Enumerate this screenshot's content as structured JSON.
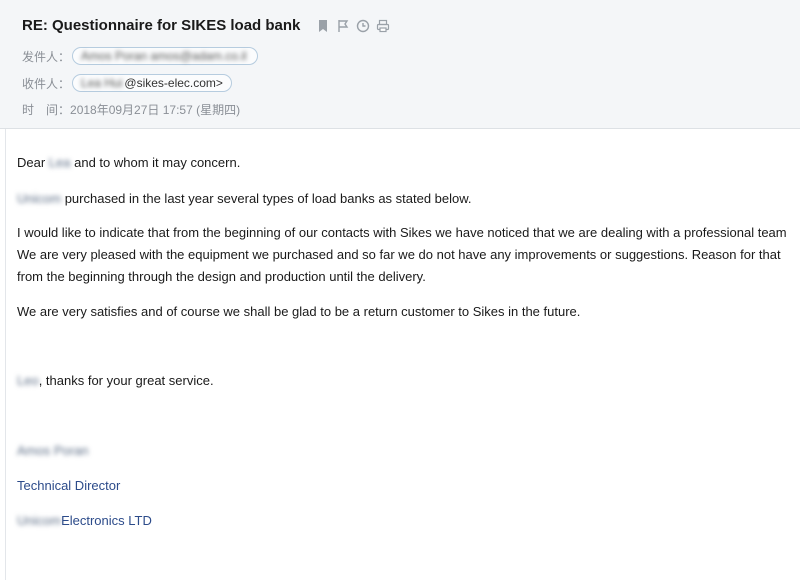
{
  "email": {
    "subject": "RE: Questionnaire for SIKES load bank",
    "toolbar_icons": [
      "flag-icon",
      "mark-icon",
      "clock-icon",
      "print-icon"
    ],
    "from_label": "发件人：",
    "from_value": "Amos Poran amos@adam.co.il",
    "to_label": "收件人：",
    "to_name": "Lea Hui",
    "to_address": "@sikes-elec.com>",
    "time_label": "时　间：",
    "time_value": "2018年09月27日 17:57 (星期四)"
  },
  "body": {
    "greeting_prefix": "Dear ",
    "greeting_name": "Lea",
    "greeting_suffix": " and to whom it may concern.",
    "p1_name": "Unicom",
    "p1_text": " purchased in the last year several types of load banks as stated below.",
    "p2_line1": "I would like to indicate that from the beginning of our contacts with Sikes we have noticed that we are dealing with a professional team",
    "p2_line2": "We are very pleased with the equipment we purchased and so far we do not have any improvements or suggestions. Reason for that",
    "p2_line3": "from the beginning through the design and production until the delivery.",
    "p3_text": "We are very satisfies and of course we shall be glad to be a return customer to Sikes in the future.",
    "thanks_name": "Leo",
    "thanks_text": ", thanks for your great service.",
    "sig_name": "Amos Poran",
    "sig_title": "Technical Director",
    "sig_company_prefix": "Unicom",
    "sig_company_suffix": "Electronics LTD"
  }
}
